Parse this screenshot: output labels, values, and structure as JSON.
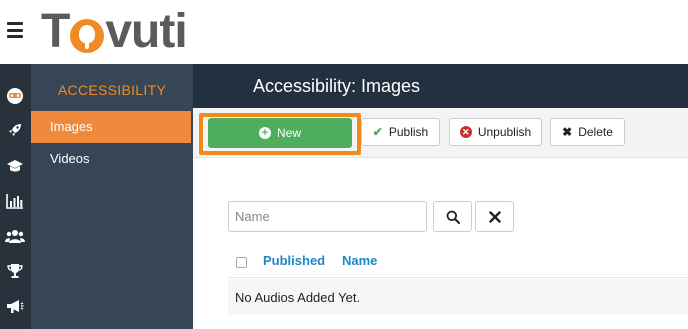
{
  "header": {
    "logo_text": "Tovuti",
    "logo_first": "T",
    "logo_rest": "vuti"
  },
  "rail": {
    "icons": [
      "avatar-icon",
      "rocket-icon",
      "graduation-cap-icon",
      "bar-chart-icon",
      "users-icon",
      "trophy-icon",
      "megaphone-icon"
    ]
  },
  "subnav": {
    "title": "ACCESSIBILITY",
    "items": [
      {
        "label": "Images",
        "active": true
      },
      {
        "label": "Videos",
        "active": false
      }
    ]
  },
  "main": {
    "title": "Accessibility: Images"
  },
  "toolbar": {
    "new_label": "New",
    "publish_label": "Publish",
    "unpublish_label": "Unpublish",
    "delete_label": "Delete"
  },
  "filter": {
    "placeholder": "Name",
    "value": ""
  },
  "table": {
    "columns": [
      "Published",
      "Name"
    ],
    "empty_message": "No Audios Added Yet."
  },
  "colors": {
    "accent_orange": "#ef8a3c",
    "success_green": "#4eae5d",
    "danger_red": "#c9302c",
    "link_blue": "#1e87c7",
    "sidebar_dark": "#27323d",
    "subnav": "#364656"
  }
}
